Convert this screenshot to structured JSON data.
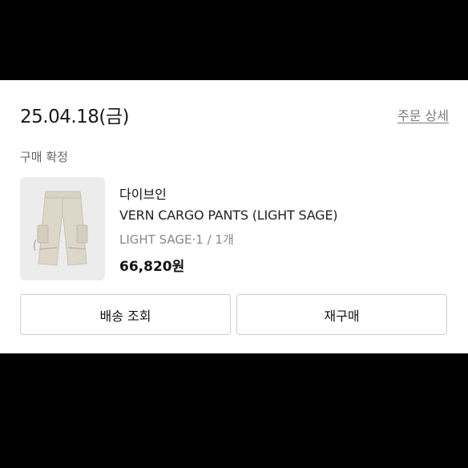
{
  "order": {
    "date": "25.04.18(금)",
    "detail_link": "주문 상세",
    "status": "구매 확정"
  },
  "product": {
    "brand": "다이브인",
    "name": "VERN CARGO PANTS (LIGHT SAGE)",
    "option": "LIGHT SAGE·1 / 1개",
    "price": "66,820원",
    "image_icon": "cargo-pants-image"
  },
  "actions": {
    "shipping_label": "배송 조회",
    "rebuy_label": "재구매"
  },
  "colors": {
    "background_bars": "#000000",
    "card": "#ffffff",
    "muted_text": "#888888",
    "button_border": "#cfcfcf"
  }
}
